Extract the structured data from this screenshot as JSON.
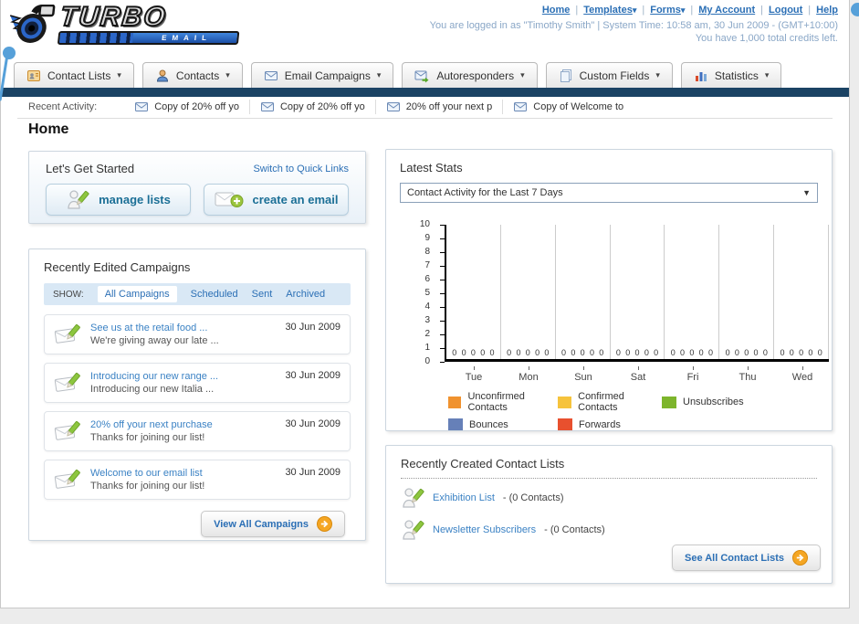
{
  "header": {
    "logo_title": "TURBO",
    "logo_subtitle": "EMAIL",
    "nav_links": [
      {
        "label": "Home",
        "menu": false
      },
      {
        "label": "Templates",
        "menu": true
      },
      {
        "label": "Forms",
        "menu": true
      },
      {
        "label": "My Account",
        "menu": false
      },
      {
        "label": "Logout",
        "menu": false
      },
      {
        "label": "Help",
        "menu": false
      }
    ],
    "status_line1": "You are logged in as \"Timothy Smith\" | System Time: 10:58 am, 30 Jun 2009 - (GMT+10:00)",
    "status_line2": "You have 1,000 total credits left."
  },
  "tabs": [
    {
      "label": "Contact Lists",
      "icon": "address-book-icon"
    },
    {
      "label": "Contacts",
      "icon": "person-icon"
    },
    {
      "label": "Email Campaigns",
      "icon": "envelope-icon"
    },
    {
      "label": "Autoresponders",
      "icon": "envelope-arrow-icon"
    },
    {
      "label": "Custom Fields",
      "icon": "pages-icon"
    },
    {
      "label": "Statistics",
      "icon": "bar-chart-icon"
    }
  ],
  "recent_activity": {
    "label": "Recent Activity:",
    "items": [
      "Copy of 20% off yo",
      "Copy of 20% off yo",
      "20% off your next p",
      "Copy of Welcome to"
    ]
  },
  "page_title": "Home",
  "get_started": {
    "title": "Let's Get Started",
    "switch_link": "Switch to Quick Links",
    "manage_lists_label": "manage lists",
    "create_email_label": "create an email"
  },
  "campaigns": {
    "title": "Recently Edited Campaigns",
    "show_label": "SHOW:",
    "filters": [
      "All Campaigns",
      "Scheduled",
      "Sent",
      "Archived"
    ],
    "active_filter": "All Campaigns",
    "items": [
      {
        "title": "See us at the retail food ...",
        "subtitle": "We're giving away our late ...",
        "date": "30 Jun 2009"
      },
      {
        "title": "Introducing our new range ...",
        "subtitle": "Introducing our new Italia ...",
        "date": "30 Jun 2009"
      },
      {
        "title": "20% off your next purchase",
        "subtitle": "Thanks for joining our list!",
        "date": "30 Jun 2009"
      },
      {
        "title": "Welcome to our email list",
        "subtitle": "Thanks for joining our list!",
        "date": "30 Jun 2009"
      }
    ],
    "view_all_label": "View All Campaigns"
  },
  "stats": {
    "title": "Latest Stats",
    "period_selected": "Contact Activity for the Last 7 Days"
  },
  "chart_data": {
    "type": "bar",
    "title": "Contact Activity for the Last 7 Days",
    "categories": [
      "Tue",
      "Mon",
      "Sun",
      "Sat",
      "Fri",
      "Thu",
      "Wed"
    ],
    "series": [
      {
        "name": "Unconfirmed Contacts",
        "color": "#F0922F",
        "values": [
          0,
          0,
          0,
          0,
          0,
          0,
          0
        ]
      },
      {
        "name": "Confirmed Contacts",
        "color": "#F6C33C",
        "values": [
          0,
          0,
          0,
          0,
          0,
          0,
          0
        ]
      },
      {
        "name": "Unsubscribes",
        "color": "#7DB52C",
        "values": [
          0,
          0,
          0,
          0,
          0,
          0,
          0
        ]
      },
      {
        "name": "Bounces",
        "color": "#6680B8",
        "values": [
          0,
          0,
          0,
          0,
          0,
          0,
          0
        ]
      },
      {
        "name": "Forwards",
        "color": "#E8502E",
        "values": [
          0,
          0,
          0,
          0,
          0,
          0,
          0
        ]
      }
    ],
    "ylim": [
      0,
      10
    ],
    "yticks": [
      0,
      1,
      2,
      3,
      4,
      5,
      6,
      7,
      8,
      9,
      10
    ],
    "value_labels_shown": true,
    "grid": "vertical",
    "legend_position": "bottom"
  },
  "contact_lists": {
    "title": "Recently Created Contact Lists",
    "items": [
      {
        "name": "Exhibition List",
        "separator": "-",
        "count": "(0 Contacts)"
      },
      {
        "name": "Newsletter Subscribers",
        "separator": "-",
        "count": "(0 Contacts)"
      }
    ],
    "see_all_label": "See All Contact Lists"
  },
  "colors": {
    "navy_bar": "#1B4364",
    "link_blue": "#2B6FB5",
    "status_text": "#8AA7C7",
    "accent_orange": "#F5A623",
    "filter_bar_bg": "#D9E8F5"
  }
}
